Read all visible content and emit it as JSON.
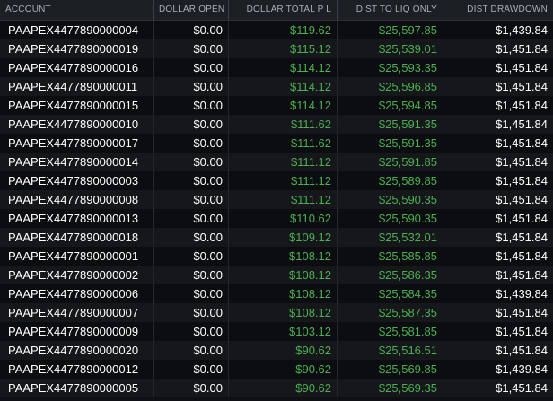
{
  "table": {
    "columns": [
      "ACCOUNT",
      "DOLLAR OPEN",
      "DOLLAR TOTAL P L",
      "DIST TO LIQ ONLY",
      "DIST DRAWDOWN"
    ],
    "rows": [
      [
        "PAAPEX4477890000004",
        "$0.00",
        "$119.62",
        "$25,597.85",
        "$1,439.84"
      ],
      [
        "PAAPEX4477890000019",
        "$0.00",
        "$115.12",
        "$25,539.01",
        "$1,451.84"
      ],
      [
        "PAAPEX4477890000016",
        "$0.00",
        "$114.12",
        "$25,593.35",
        "$1,451.84"
      ],
      [
        "PAAPEX4477890000011",
        "$0.00",
        "$114.12",
        "$25,596.85",
        "$1,451.84"
      ],
      [
        "PAAPEX4477890000015",
        "$0.00",
        "$114.12",
        "$25,594.85",
        "$1,451.84"
      ],
      [
        "PAAPEX4477890000010",
        "$0.00",
        "$111.62",
        "$25,591.35",
        "$1,451.84"
      ],
      [
        "PAAPEX4477890000017",
        "$0.00",
        "$111.62",
        "$25,591.35",
        "$1,451.84"
      ],
      [
        "PAAPEX4477890000014",
        "$0.00",
        "$111.12",
        "$25,591.85",
        "$1,451.84"
      ],
      [
        "PAAPEX4477890000003",
        "$0.00",
        "$111.12",
        "$25,589.85",
        "$1,451.84"
      ],
      [
        "PAAPEX4477890000008",
        "$0.00",
        "$111.12",
        "$25,590.35",
        "$1,451.84"
      ],
      [
        "PAAPEX4477890000013",
        "$0.00",
        "$110.62",
        "$25,590.35",
        "$1,451.84"
      ],
      [
        "PAAPEX4477890000018",
        "$0.00",
        "$109.12",
        "$25,532.01",
        "$1,451.84"
      ],
      [
        "PAAPEX4477890000001",
        "$0.00",
        "$108.12",
        "$25,585.85",
        "$1,451.84"
      ],
      [
        "PAAPEX4477890000002",
        "$0.00",
        "$108.12",
        "$25,586.35",
        "$1,451.84"
      ],
      [
        "PAAPEX4477890000006",
        "$0.00",
        "$108.12",
        "$25,584.35",
        "$1,439.84"
      ],
      [
        "PAAPEX4477890000007",
        "$0.00",
        "$108.12",
        "$25,587.35",
        "$1,451.84"
      ],
      [
        "PAAPEX4477890000009",
        "$0.00",
        "$103.12",
        "$25,581.85",
        "$1,451.84"
      ],
      [
        "PAAPEX4477890000020",
        "$0.00",
        "$90.62",
        "$25,516.51",
        "$1,451.84"
      ],
      [
        "PAAPEX4477890000012",
        "$0.00",
        "$90.62",
        "$25,569.85",
        "$1,439.84"
      ],
      [
        "PAAPEX4477890000005",
        "$0.00",
        "$90.62",
        "$25,569.35",
        "$1,451.84"
      ]
    ]
  },
  "colors": {
    "positive": "#4caf50",
    "text": "#ffffff",
    "header_text": "#a9adb4",
    "background": "#0e1014"
  }
}
